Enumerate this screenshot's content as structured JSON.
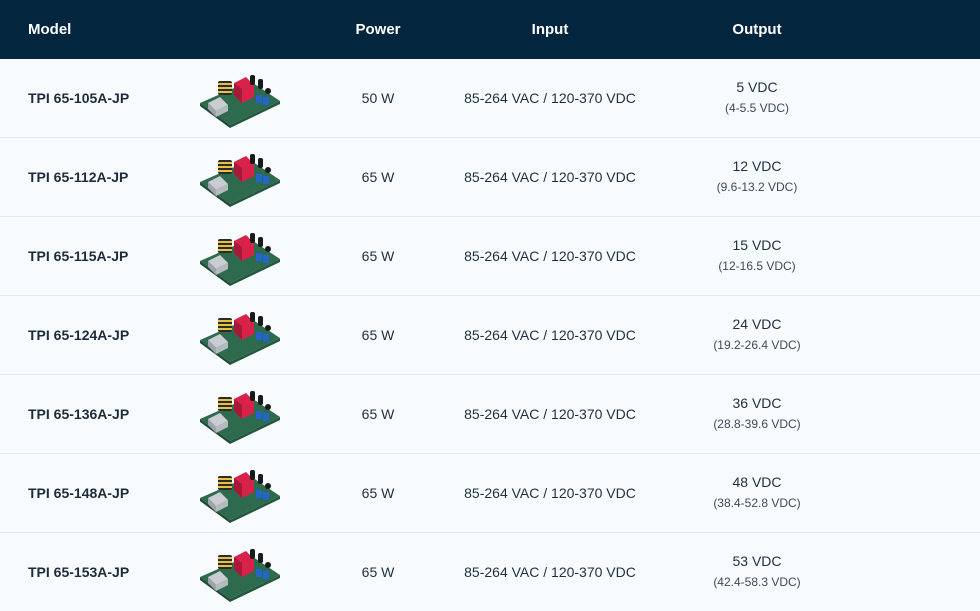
{
  "header": {
    "model": "Model",
    "power": "Power",
    "input": "Input",
    "output": "Output"
  },
  "rows": [
    {
      "model": "TPI 65-105A-JP",
      "power": "50 W",
      "input": "85-264 VAC / 120-370 VDC",
      "output": "5 VDC",
      "range": "(4-5.5 VDC)"
    },
    {
      "model": "TPI 65-112A-JP",
      "power": "65 W",
      "input": "85-264 VAC / 120-370 VDC",
      "output": "12 VDC",
      "range": "(9.6-13.2 VDC)"
    },
    {
      "model": "TPI 65-115A-JP",
      "power": "65 W",
      "input": "85-264 VAC / 120-370 VDC",
      "output": "15 VDC",
      "range": "(12-16.5 VDC)"
    },
    {
      "model": "TPI 65-124A-JP",
      "power": "65 W",
      "input": "85-264 VAC / 120-370 VDC",
      "output": "24 VDC",
      "range": "(19.2-26.4 VDC)"
    },
    {
      "model": "TPI 65-136A-JP",
      "power": "65 W",
      "input": "85-264 VAC / 120-370 VDC",
      "output": "36 VDC",
      "range": "(28.8-39.6 VDC)"
    },
    {
      "model": "TPI 65-148A-JP",
      "power": "65 W",
      "input": "85-264 VAC / 120-370 VDC",
      "output": "48 VDC",
      "range": "(38.4-52.8 VDC)"
    },
    {
      "model": "TPI 65-153A-JP",
      "power": "65 W",
      "input": "85-264 VAC / 120-370 VDC",
      "output": "53 VDC",
      "range": "(42.4-58.3 VDC)"
    }
  ],
  "colors": {
    "header_bg": "#03253d",
    "row_bg": "#f8fbfe",
    "divider": "#e3e9ef",
    "text": "#1d2b3a"
  },
  "product_image_icon": "pcb-module-icon"
}
